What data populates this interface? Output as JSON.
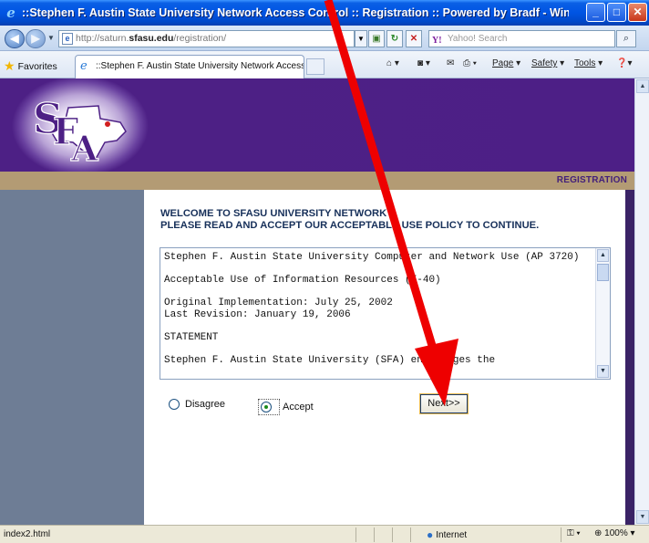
{
  "window": {
    "title": "::Stephen F. Austin State University Network Access Control :: Registration :: Powered by Bradf - Windows Internet E..."
  },
  "address_bar": {
    "url_prefix": "http://saturn.",
    "url_domain": "sfasu.edu",
    "url_path": "/registration/",
    "search_placeholder": "Yahoo! Search"
  },
  "toolbar": {
    "favorites_label": "Favorites",
    "tab_title": "::Stephen F. Austin State University Network Access ...",
    "page_label": "Page",
    "safety_label": "Safety",
    "tools_label": "Tools"
  },
  "page": {
    "section_label": "REGISTRATION",
    "welcome_line1": "WELCOME TO SFASU UNIVERSITY NETWORK",
    "welcome_line2": "PLEASE READ AND ACCEPT OUR ACCEPTABLE USE POLICY TO  CONTINUE.",
    "policy_text": "Stephen F. Austin State University Computer and Network Use (AP 3720)\n\nAcceptable Use of Information Resources (F-40)\n\nOriginal Implementation: July 25, 2002\nLast Revision: January 19, 2006\n\nSTATEMENT\n\nStephen F. Austin State University (SFA) encourages the",
    "disagree_label": "Disagree",
    "accept_label": "Accept",
    "selected_option": "Accept",
    "next_button": "Next>>"
  },
  "statusbar": {
    "status_text": "index2.html",
    "zone": "Internet",
    "zoom": "100%"
  },
  "colors": {
    "banner_purple": "#4d2085",
    "tan_bar": "#B39B74",
    "left_column": "#6E7D95",
    "annotation_arrow": "#ee0000"
  }
}
